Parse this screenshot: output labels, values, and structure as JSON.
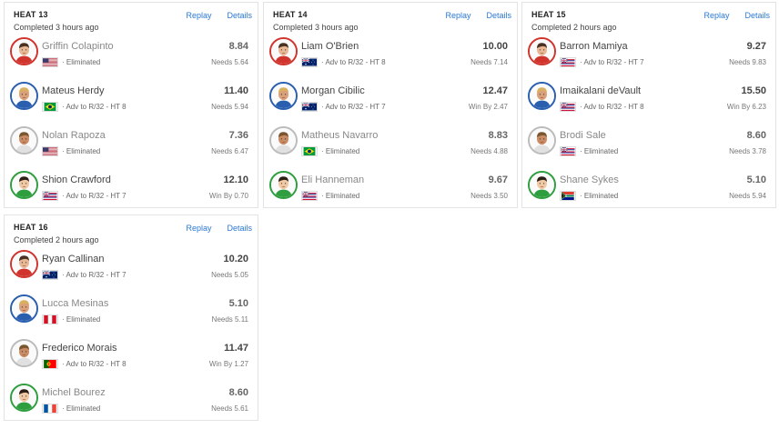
{
  "heats": [
    {
      "title": "HEAT 13",
      "status": "Completed 3 hours ago",
      "replay_label": "Replay",
      "details_label": "Details",
      "athletes": [
        {
          "name": "Griffin Colapinto",
          "flag": "USA",
          "result": "· Eliminated",
          "score": "8.84",
          "needs": "Needs 5.64",
          "jersey_color": "#d0342c",
          "eliminated": true
        },
        {
          "name": "Mateus Herdy",
          "flag": "BRA",
          "result": "· Adv to R/32 - HT 8",
          "score": "11.40",
          "needs": "Needs 5.94",
          "jersey_color": "#2a5fb0",
          "eliminated": false
        },
        {
          "name": "Nolan Rapoza",
          "flag": "USA",
          "result": "· Eliminated",
          "score": "7.36",
          "needs": "Needs 6.47",
          "jersey_color": "#e0e0e0",
          "eliminated": true
        },
        {
          "name": "Shion Crawford",
          "flag": "HAW",
          "result": "· Adv to R/32 - HT 7",
          "score": "12.10",
          "needs": "Win By 0.70",
          "jersey_color": "#2e9e3e",
          "eliminated": false
        }
      ]
    },
    {
      "title": "HEAT 14",
      "status": "Completed 3 hours ago",
      "replay_label": "Replay",
      "details_label": "Details",
      "athletes": [
        {
          "name": "Liam O'Brien",
          "flag": "AUS",
          "result": "· Adv to R/32 - HT 8",
          "score": "10.00",
          "needs": "Needs 7.14",
          "jersey_color": "#d0342c",
          "eliminated": false
        },
        {
          "name": "Morgan Cibilic",
          "flag": "AUS",
          "result": "· Adv to R/32 - HT 7",
          "score": "12.47",
          "needs": "Win By 2.47",
          "jersey_color": "#2a5fb0",
          "eliminated": false
        },
        {
          "name": "Matheus Navarro",
          "flag": "BRA",
          "result": "· Eliminated",
          "score": "8.83",
          "needs": "Needs 4.88",
          "jersey_color": "#e0e0e0",
          "eliminated": true
        },
        {
          "name": "Eli Hanneman",
          "flag": "HAW",
          "result": "· Eliminated",
          "score": "9.67",
          "needs": "Needs 3.50",
          "jersey_color": "#2e9e3e",
          "eliminated": true
        }
      ]
    },
    {
      "title": "HEAT 15",
      "status": "Completed 2 hours ago",
      "replay_label": "Replay",
      "details_label": "Details",
      "athletes": [
        {
          "name": "Barron Mamiya",
          "flag": "HAW",
          "result": "· Adv to R/32 - HT 7",
          "score": "9.27",
          "needs": "Needs 9.83",
          "jersey_color": "#d0342c",
          "eliminated": false
        },
        {
          "name": "Imaikalani deVault",
          "flag": "HAW",
          "result": "· Adv to R/32 - HT 8",
          "score": "15.50",
          "needs": "Win By 6.23",
          "jersey_color": "#2a5fb0",
          "eliminated": false
        },
        {
          "name": "Brodi Sale",
          "flag": "HAW",
          "result": "· Eliminated",
          "score": "8.60",
          "needs": "Needs 3.78",
          "jersey_color": "#e0e0e0",
          "eliminated": true
        },
        {
          "name": "Shane Sykes",
          "flag": "RSA",
          "result": "· Eliminated",
          "score": "5.10",
          "needs": "Needs 5.94",
          "jersey_color": "#2e9e3e",
          "eliminated": true
        }
      ]
    },
    {
      "title": "HEAT 16",
      "status": "Completed 2 hours ago",
      "replay_label": "Replay",
      "details_label": "Details",
      "athletes": [
        {
          "name": "Ryan Callinan",
          "flag": "AUS",
          "result": "· Adv to R/32 - HT 7",
          "score": "10.20",
          "needs": "Needs 5.05",
          "jersey_color": "#d0342c",
          "eliminated": false
        },
        {
          "name": "Lucca Mesinas",
          "flag": "PER",
          "result": "· Eliminated",
          "score": "5.10",
          "needs": "Needs 5.11",
          "jersey_color": "#2a5fb0",
          "eliminated": true
        },
        {
          "name": "Frederico Morais",
          "flag": "POR",
          "result": "· Adv to R/32 - HT 8",
          "score": "11.47",
          "needs": "Win By 1.27",
          "jersey_color": "#e0e0e0",
          "eliminated": false
        },
        {
          "name": "Michel Bourez",
          "flag": "FRA",
          "result": "· Eliminated",
          "score": "8.60",
          "needs": "Needs 5.61",
          "jersey_color": "#2e9e3e",
          "eliminated": true
        }
      ]
    }
  ]
}
